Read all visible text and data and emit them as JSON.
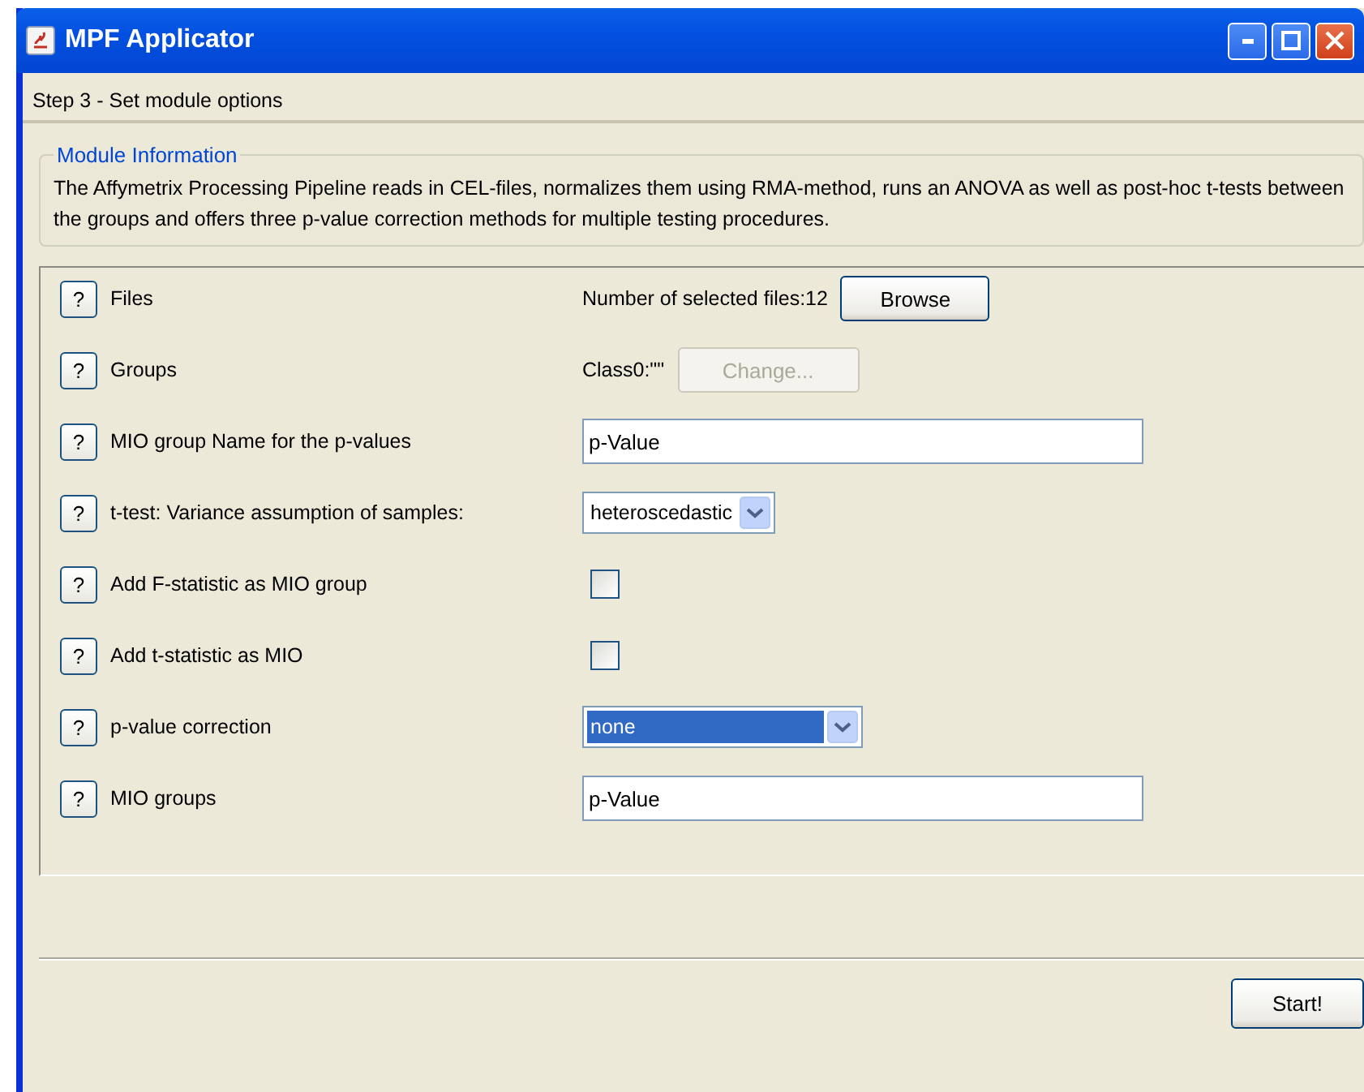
{
  "window": {
    "title": "MPF Applicator"
  },
  "step": "Step 3 - Set module options",
  "module_info": {
    "title": "Module Information",
    "text": "The Affymetrix Processing Pipeline reads in CEL-files, normalizes them using RMA-method, runs an ANOVA as well as post-hoc t-tests between the groups and offers three p-value correction methods for multiple testing procedures."
  },
  "options": [
    {
      "help": "?",
      "label": "Files",
      "kind": "button",
      "info": "Number of selected files:12",
      "button": "Browse",
      "disabled": false
    },
    {
      "help": "?",
      "label": "Groups",
      "kind": "button",
      "info": "Class0:\"\"",
      "button": "Change...",
      "disabled": true
    },
    {
      "help": "?",
      "label": "MIO group Name for the p-values",
      "kind": "text",
      "value": "p-Value"
    },
    {
      "help": "?",
      "label": "t-test: Variance assumption of samples:",
      "kind": "select",
      "value": "heteroscedastic",
      "focused": false
    },
    {
      "help": "?",
      "label": "Add F-statistic as MIO group",
      "kind": "checkbox",
      "checked": false
    },
    {
      "help": "?",
      "label": "Add t-statistic as MIO",
      "kind": "checkbox",
      "checked": false
    },
    {
      "help": "?",
      "label": "p-value correction",
      "kind": "select",
      "value": "none",
      "focused": true
    },
    {
      "help": "?",
      "label": "MIO groups",
      "kind": "text",
      "value": "p-Value"
    }
  ],
  "start_button": "Start!"
}
